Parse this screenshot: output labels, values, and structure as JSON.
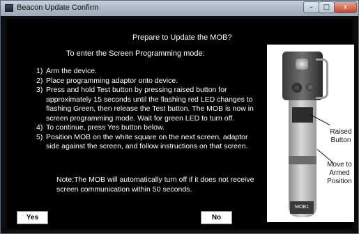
{
  "window": {
    "title": "Beacon Update Confirm",
    "controls": {
      "minimize": "–",
      "maximize": "□",
      "close": "x"
    }
  },
  "dialog": {
    "heading": "Prepare to Update the MOB?",
    "subheading": "To enter the Screen Programming mode:",
    "steps": [
      {
        "num": "1)",
        "text": "Arm the device."
      },
      {
        "num": "2)",
        "text": "Place programming adaptor onto device."
      },
      {
        "num": "3)",
        "text": "Press and hold Test button by pressing raised button for approximately 15 seconds until the flashing red LED changes to flashing Green, then release the Test button. The MOB is now in screen programming mode. Wait for green LED to turn off."
      },
      {
        "num": "4)",
        "text": "To continue, press Yes button below."
      },
      {
        "num": "5)",
        "text": "Position MOB on the white square on the next screen, adaptor side against the screen, and follow instructions on that screen."
      }
    ],
    "note": "Note:The MOB will automatically turn off if it does not receive screen communication within 50 seconds.",
    "photo": {
      "callout_raised": "Raised Button",
      "callout_move": "Move to Armed Position",
      "device_label": "MOB1"
    },
    "buttons": {
      "yes": "Yes",
      "no": "No"
    }
  }
}
